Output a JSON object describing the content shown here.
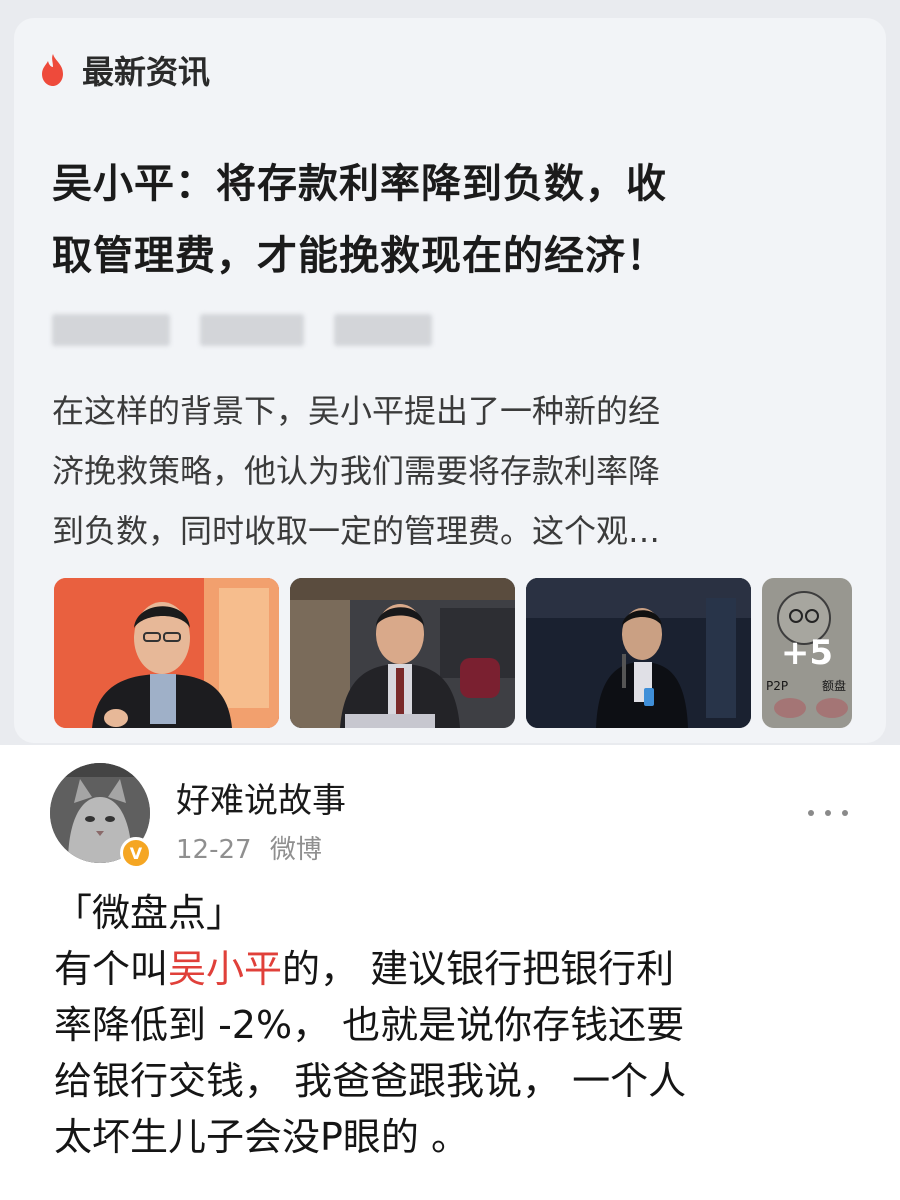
{
  "news_card": {
    "section_label": "最新资讯",
    "headline_lines": [
      "吴小平：将存款利率降到负数，收",
      "取管理费，才能挽救现在的经济！"
    ],
    "summary_lines": [
      "在这样的背景下，吴小平提出了一种新的经",
      "济挽救策略，他认为我们需要将存款利率降",
      "到负数，同时收取一定的管理费。这个观…"
    ],
    "more_images_count": "+5",
    "thumbnail_captions": [
      "P2P",
      "额盘"
    ],
    "icon_names": [
      "flame-icon"
    ],
    "accent_color": "#ee4a3b"
  },
  "post": {
    "username": "好难说故事",
    "date": "12-27",
    "source": "微博",
    "tag": "「微盘点」",
    "body_prefix": "有个叫",
    "mention": "吴小平",
    "body_line1_suffix": "的， 建议银行把银行利",
    "body_line2": "率降低到 -2%， 也就是说你存钱还要",
    "body_line3": "给银行交钱， 我爸爸跟我说， 一个人",
    "body_line4": "太坏生儿子会没P眼的 。",
    "mention_color": "#e0403a",
    "verified_badge": "V",
    "icon_names": [
      "verified-icon",
      "more-icon"
    ]
  }
}
